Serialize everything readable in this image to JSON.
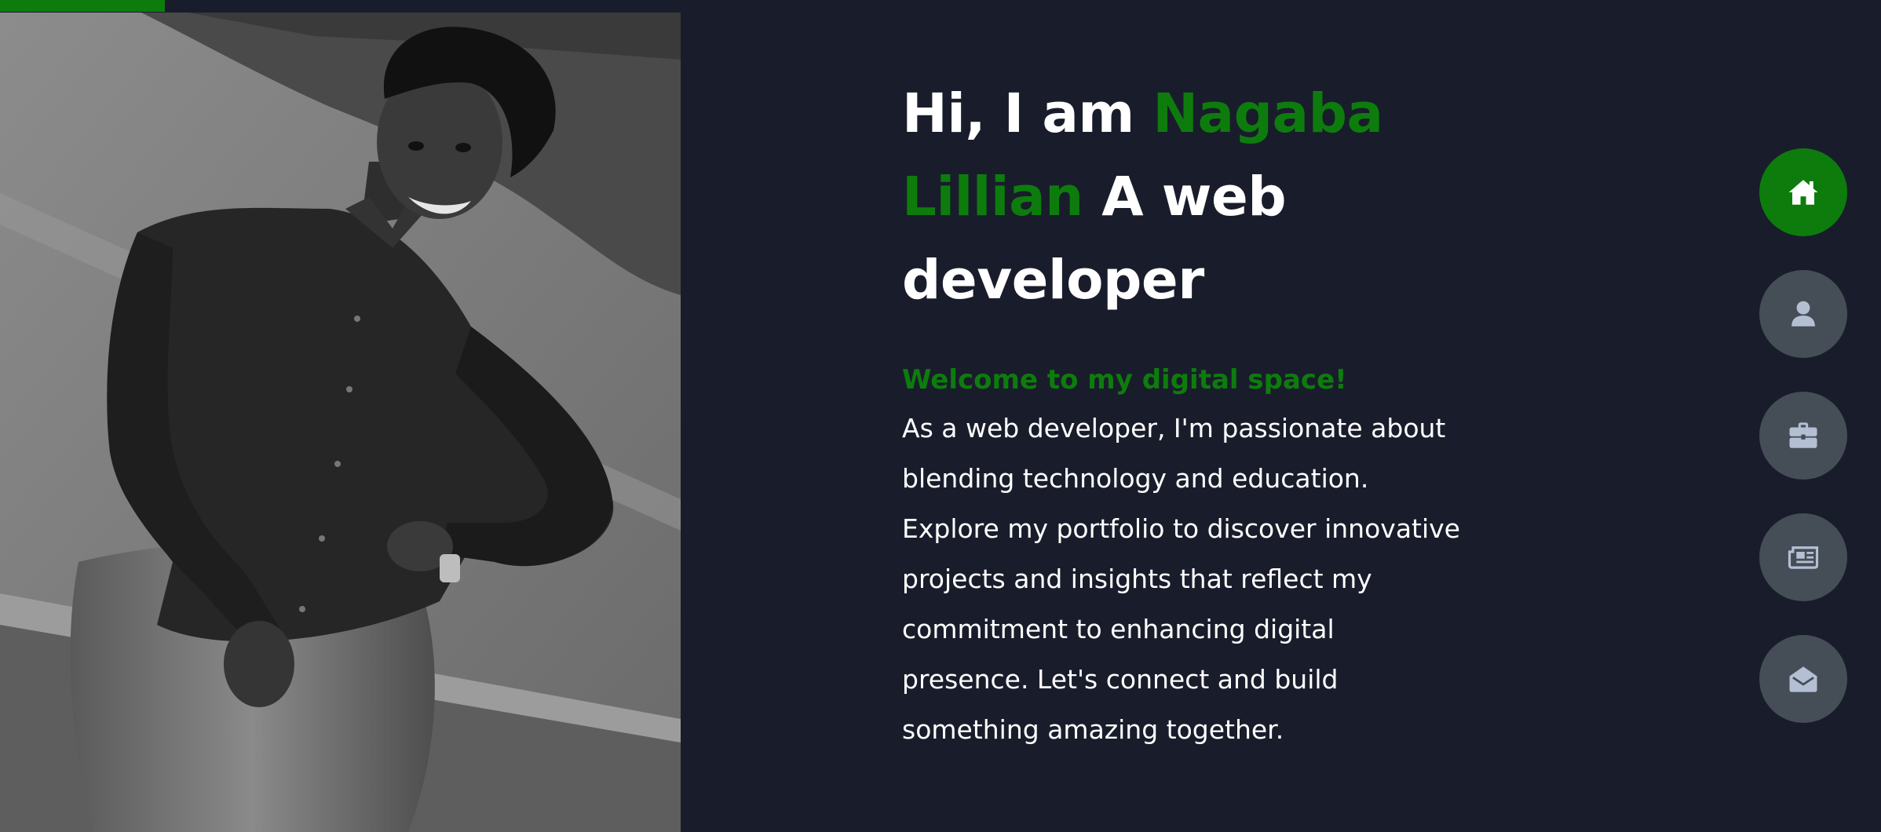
{
  "hero": {
    "greeting": "Hi, I am ",
    "name": "Nagaba Lillian",
    "role": " A web developer",
    "welcome": "Welcome to my digital space!",
    "bio": "As a web developer, I'm passionate about blending technology and education. Explore my portfolio to discover innovative projects and insights that reflect my commitment to enhancing digital presence. Let's connect and build something amazing together."
  },
  "photo": {
    "alt": "Black and white photo of Nagaba Lillian smiling, standing outdoors"
  },
  "nav": {
    "items": [
      {
        "icon": "home-icon",
        "active": true
      },
      {
        "icon": "user-icon",
        "active": false
      },
      {
        "icon": "briefcase-icon",
        "active": false
      },
      {
        "icon": "newspaper-icon",
        "active": false
      },
      {
        "icon": "envelope-open-icon",
        "active": false
      }
    ]
  },
  "colors": {
    "background": "#191d2b",
    "accent": "#0d7c0d",
    "nav_inactive": "#454e56",
    "icon_inactive": "#b4bfd3",
    "text": "#ffffff"
  }
}
